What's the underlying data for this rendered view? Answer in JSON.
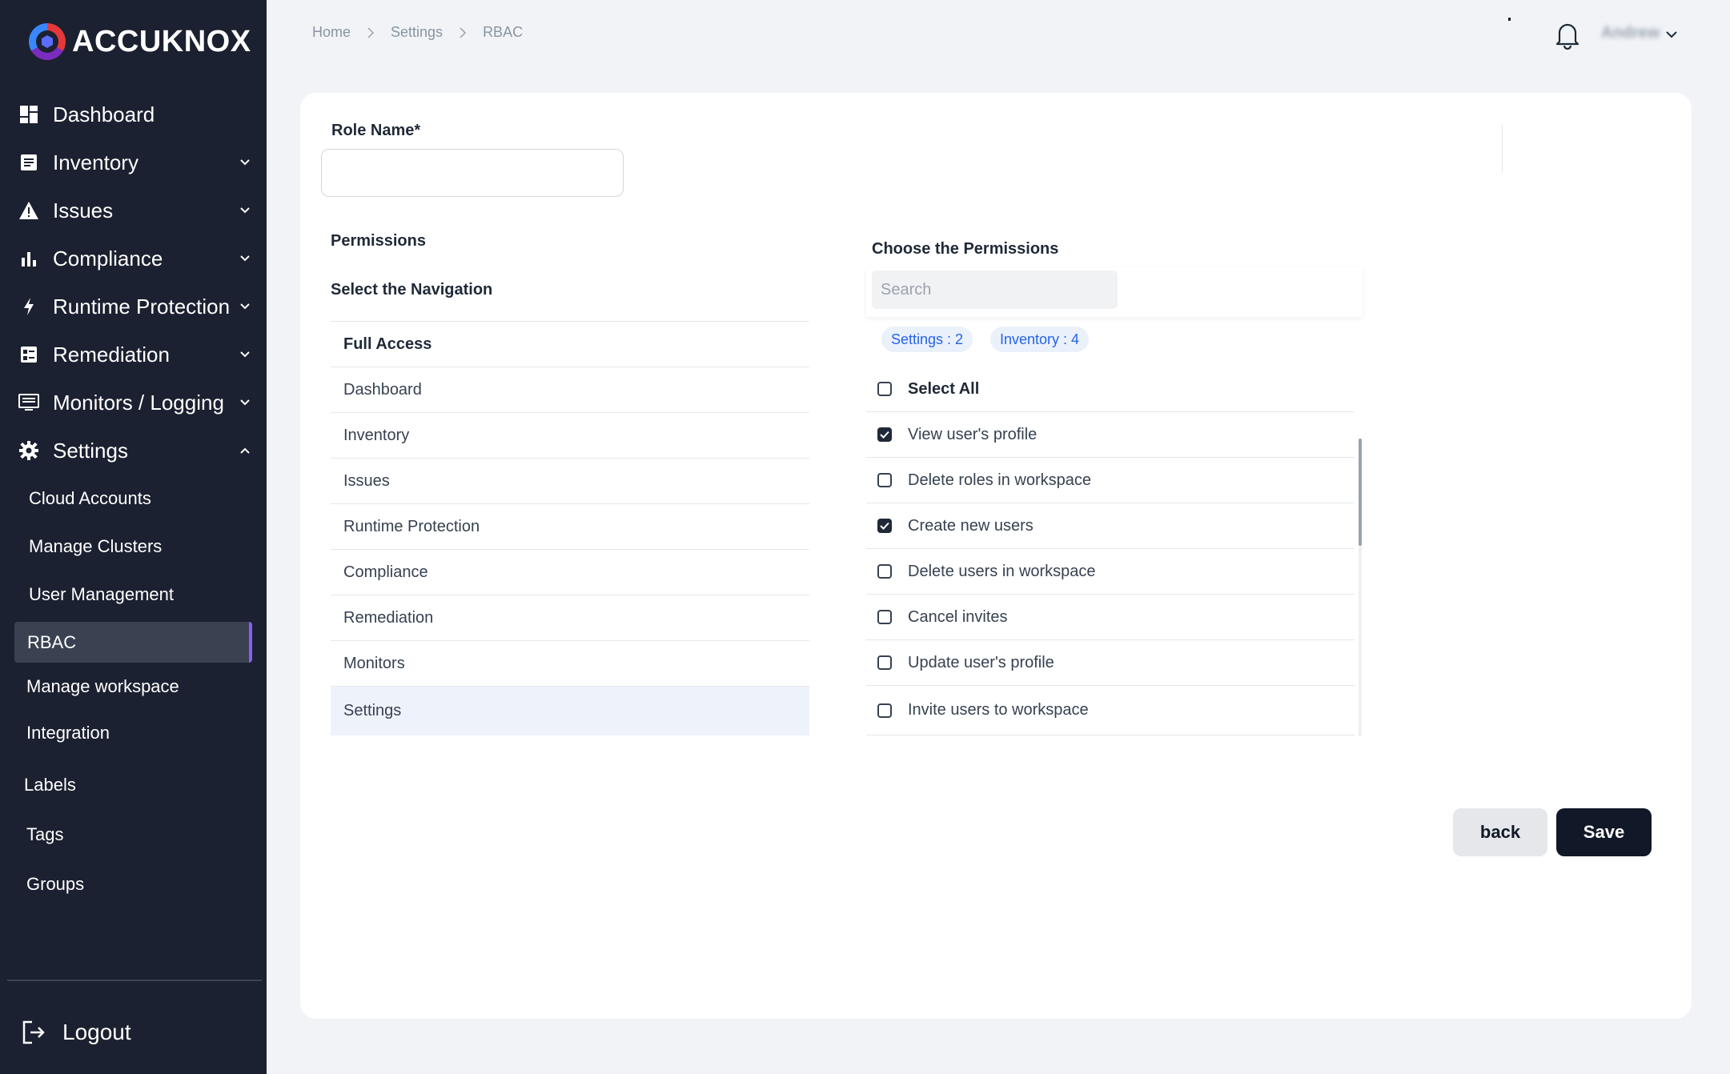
{
  "brand": {
    "name": "ACCUKNOX"
  },
  "sidebar": {
    "items": [
      {
        "label": "Dashboard",
        "icon": "dashboard-icon"
      },
      {
        "label": "Inventory",
        "icon": "inventory-icon"
      },
      {
        "label": "Issues",
        "icon": "warning-icon"
      },
      {
        "label": "Compliance",
        "icon": "bar-chart-icon"
      },
      {
        "label": "Runtime Protection",
        "icon": "bolt-icon"
      },
      {
        "label": "Remediation",
        "icon": "remediation-icon"
      },
      {
        "label": "Monitors / Logging",
        "icon": "monitor-icon"
      },
      {
        "label": "Settings",
        "icon": "gear-icon"
      }
    ],
    "settings_sub": [
      "Cloud Accounts",
      "Manage Clusters",
      "User Management",
      "RBAC",
      "Manage workspace",
      "Integration",
      "Labels",
      "Tags",
      "Groups"
    ],
    "logout": "Logout"
  },
  "breadcrumb": [
    "Home",
    "Settings",
    "RBAC"
  ],
  "header": {
    "user": "Andrew"
  },
  "form": {
    "role_label": "Role Name*",
    "role_value": "",
    "permissions_label": "Permissions",
    "select_nav_label": "Select the Navigation",
    "nav_items": [
      "Full Access",
      "Dashboard",
      "Inventory",
      "Issues",
      "Runtime Protection",
      "Compliance",
      "Remediation",
      "Monitors",
      "Settings"
    ],
    "choose_label": "Choose the Permissions",
    "search_placeholder": "Search",
    "chips": [
      "Settings : 2",
      "Inventory : 4"
    ],
    "select_all": "Select All",
    "permissions": [
      {
        "label": "View user's profile",
        "checked": true
      },
      {
        "label": "Delete roles in workspace",
        "checked": false
      },
      {
        "label": "Create new users",
        "checked": true
      },
      {
        "label": "Delete users in workspace",
        "checked": false
      },
      {
        "label": "Cancel invites",
        "checked": false
      },
      {
        "label": "Update user's profile",
        "checked": false
      },
      {
        "label": "Invite users to workspace",
        "checked": false
      }
    ],
    "back_label": "back",
    "save_label": "Save"
  }
}
